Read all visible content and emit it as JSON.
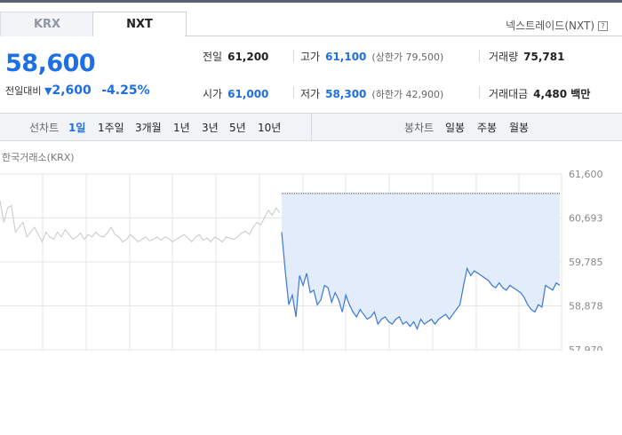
{
  "tabs": [
    {
      "label": "KRX"
    },
    {
      "label": "NXT"
    }
  ],
  "nxt_link": "넥스트레이드(NXT)",
  "price": "58,600",
  "change": {
    "label": "전일대비",
    "direction": "down",
    "amount": "2,600",
    "percent": "-4.25%"
  },
  "stats": {
    "prev_close": {
      "label": "전일",
      "value": "61,200"
    },
    "high": {
      "label": "고가",
      "value": "61,100",
      "sub": "(상한가 79,500)"
    },
    "volume": {
      "label": "거래량",
      "value": "75,781"
    },
    "open": {
      "label": "시가",
      "value": "61,000"
    },
    "low": {
      "label": "저가",
      "value": "58,300",
      "sub": "(하한가 42,900)"
    },
    "amount": {
      "label": "거래대금",
      "value": "4,480 백만"
    }
  },
  "line_chart": {
    "label": "선차트",
    "periods": [
      "1일",
      "1주일",
      "3개월",
      "1년",
      "3년",
      "5년",
      "10년"
    ],
    "active": "1일"
  },
  "candle_chart": {
    "label": "봉차트",
    "periods": [
      "일봉",
      "주봉",
      "월봉"
    ]
  },
  "chart_data": {
    "type": "line",
    "title": "한국거래소(KRX)",
    "y_ticks": [
      "61,600",
      "60,693",
      "59,785",
      "58,878",
      "57,970"
    ],
    "ylim": [
      57970,
      61600
    ],
    "reference_price": 61200,
    "series": [
      {
        "values": [
          61050,
          60600,
          60900,
          60950,
          60400,
          60500,
          60600,
          60300,
          60400,
          60500,
          60350,
          60200,
          60400,
          60300,
          60250,
          60400,
          60300,
          60450,
          60350,
          60250,
          60300,
          60380,
          60250,
          60350,
          60300,
          60400,
          60320,
          60300,
          60380,
          60500,
          60350,
          60300,
          60200,
          60250,
          60350,
          60280,
          60200,
          60250,
          60300,
          60220,
          60250,
          60300,
          60230,
          60300,
          60270,
          60200,
          60250,
          60300,
          60350,
          60280,
          60200,
          60300,
          60350,
          60230,
          60280,
          60200,
          60300,
          60250,
          60200,
          60300,
          60270,
          60250,
          60300,
          60380,
          60420,
          60350,
          60500,
          60600,
          60550,
          60700,
          60850,
          60750,
          60900,
          60800
        ]
      },
      {
        "values": [
          60400,
          59600,
          58900,
          59100,
          58650,
          59500,
          59300,
          59550,
          59150,
          59200,
          58900,
          59000,
          59300,
          59250,
          58950,
          59150,
          59000,
          58750,
          59100,
          58900,
          58750,
          58650,
          58800,
          58700,
          58600,
          58650,
          58750,
          58500,
          58600,
          58650,
          58550,
          58500,
          58600,
          58650,
          58500,
          58550,
          58450,
          58550,
          58400,
          58600,
          58500,
          58550,
          58600,
          58500,
          58600,
          58650,
          58700,
          58600,
          58700,
          58800,
          58900,
          59300,
          59650,
          59500,
          59600,
          59550,
          59500,
          59450,
          59400,
          59300,
          59250,
          59350,
          59250,
          59200,
          59300,
          59250,
          59200,
          59150,
          59050,
          58900,
          58800,
          58750,
          58900,
          58850,
          59300,
          59250,
          59200,
          59350,
          59300
        ]
      }
    ]
  }
}
